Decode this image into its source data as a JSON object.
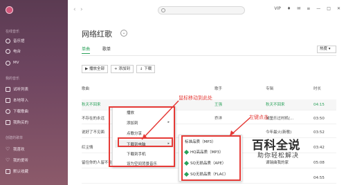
{
  "sidebar": {
    "section_online": "在线音乐",
    "online_items": [
      {
        "label": "音乐馆",
        "icon": "music-hall-icon"
      },
      {
        "label": "电台",
        "icon": "radio-icon"
      },
      {
        "label": "MV",
        "icon": "mv-icon"
      }
    ],
    "section_mine": "我的音乐",
    "mine_items": [
      {
        "label": "试听列表",
        "icon": "playlist-icon"
      },
      {
        "label": "本地导入",
        "icon": "import-icon"
      },
      {
        "label": "下载歌曲",
        "icon": "download-icon"
      },
      {
        "label": "我购买的",
        "icon": "purchased-icon"
      }
    ],
    "section_created": "创建的歌单",
    "created_items": [
      {
        "label": "我喜欢",
        "icon": "heart-icon"
      },
      {
        "label": "我的爱听",
        "icon": "heart-icon"
      },
      {
        "label": "默认收藏",
        "icon": "folder-icon"
      }
    ]
  },
  "topbar": {
    "back": "‹",
    "forward": "›",
    "icons": [
      "vip-icon",
      "shirt-icon",
      "mail-icon",
      "menu-icon",
      "minimize-icon",
      "maximize-icon",
      "close-icon"
    ],
    "icon_glyphs": [
      "VIP",
      "♦",
      "✉",
      "≡",
      "—",
      "□",
      "✕"
    ]
  },
  "page": {
    "title": "网络红歌",
    "tabs": [
      {
        "label": "单曲",
        "active": true
      },
      {
        "label": "歌单",
        "active": false
      }
    ],
    "hot_select": "热度 ▾"
  },
  "toolbar": {
    "play_all": "▶ 播放全部",
    "add_to": "+ 添加到",
    "download": "↓ 下载"
  },
  "table": {
    "headers": {
      "song": "歌曲",
      "singer": "歌手",
      "album": "专辑",
      "duration": "时长"
    },
    "rows": [
      {
        "song": "秋天不回来",
        "singer": "王强",
        "album": "秋天不回来",
        "duration": "04:15",
        "highlight": true
      },
      {
        "song": "不存在的永远",
        "singer": "乔洋",
        "album": "城堡乐过村机(...",
        "duration": "03:50"
      },
      {
        "song": "说好了不见面",
        "singer": "",
        "album": "今年最火(新歌)",
        "duration": "03:52"
      },
      {
        "song": "红尘情",
        "singer": "",
        "album": "",
        "duration": "03:42"
      },
      {
        "song": "留住你的人留不住你的心",
        "singer": "",
        "album": "谭瑞曲我的家",
        "duration": "05:08"
      },
      {
        "song": "",
        "singer": "",
        "album": "",
        "duration": "04:55"
      }
    ]
  },
  "context_menu": {
    "items": [
      "播放",
      "添加到",
      "点歌分享",
      "下载到电脑",
      "下载到手机",
      "设为空间背景音乐"
    ],
    "submenu_indicator": "▸"
  },
  "submenu": {
    "items": [
      "标准品质（MP3）",
      "HQ高品质（MP3）",
      "SQ无损品质（APE）",
      "SQ无损品质（FLAC）"
    ]
  },
  "annotations": {
    "move_hint": "鼠标移动到此处",
    "left_click": "左键点击"
  },
  "watermark": {
    "main": "百科全说",
    "sub": "助你轻松解决"
  },
  "colors": {
    "accent_green": "#2aa15a",
    "annotation_red": "#e53935",
    "sidebar_top": "#5b3b52"
  }
}
